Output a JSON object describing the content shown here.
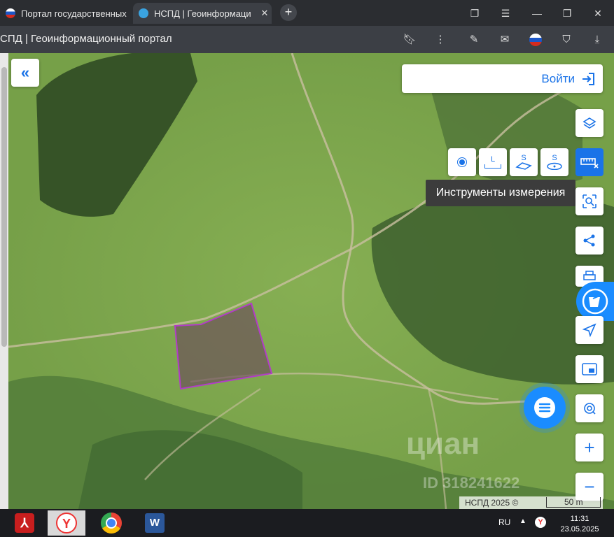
{
  "browser": {
    "tabs": [
      {
        "label": "Портал государственных",
        "active": false
      },
      {
        "label": "НСПД | Геоинформаци",
        "active": true
      }
    ],
    "address_text": "СПД | Геоинформационный портал"
  },
  "map": {
    "login_label": "Войти",
    "tooltip": "Инструменты измерения",
    "measure_tools": [
      {
        "icon": "point-icon",
        "label": ""
      },
      {
        "icon": "length-icon",
        "label": "L"
      },
      {
        "icon": "area-icon",
        "label": "S"
      },
      {
        "icon": "circle-area-icon",
        "label": "S"
      }
    ],
    "attribution": "НСПД 2025 ©",
    "scale_label": "50 m",
    "watermark": "циан",
    "watermark_id": "ID 318241622"
  },
  "taskbar": {
    "lang": "RU",
    "time": "11:31",
    "date": "23.05.2025"
  },
  "colors": {
    "accent": "#1a73e8",
    "parcel": "#b23cc8"
  }
}
